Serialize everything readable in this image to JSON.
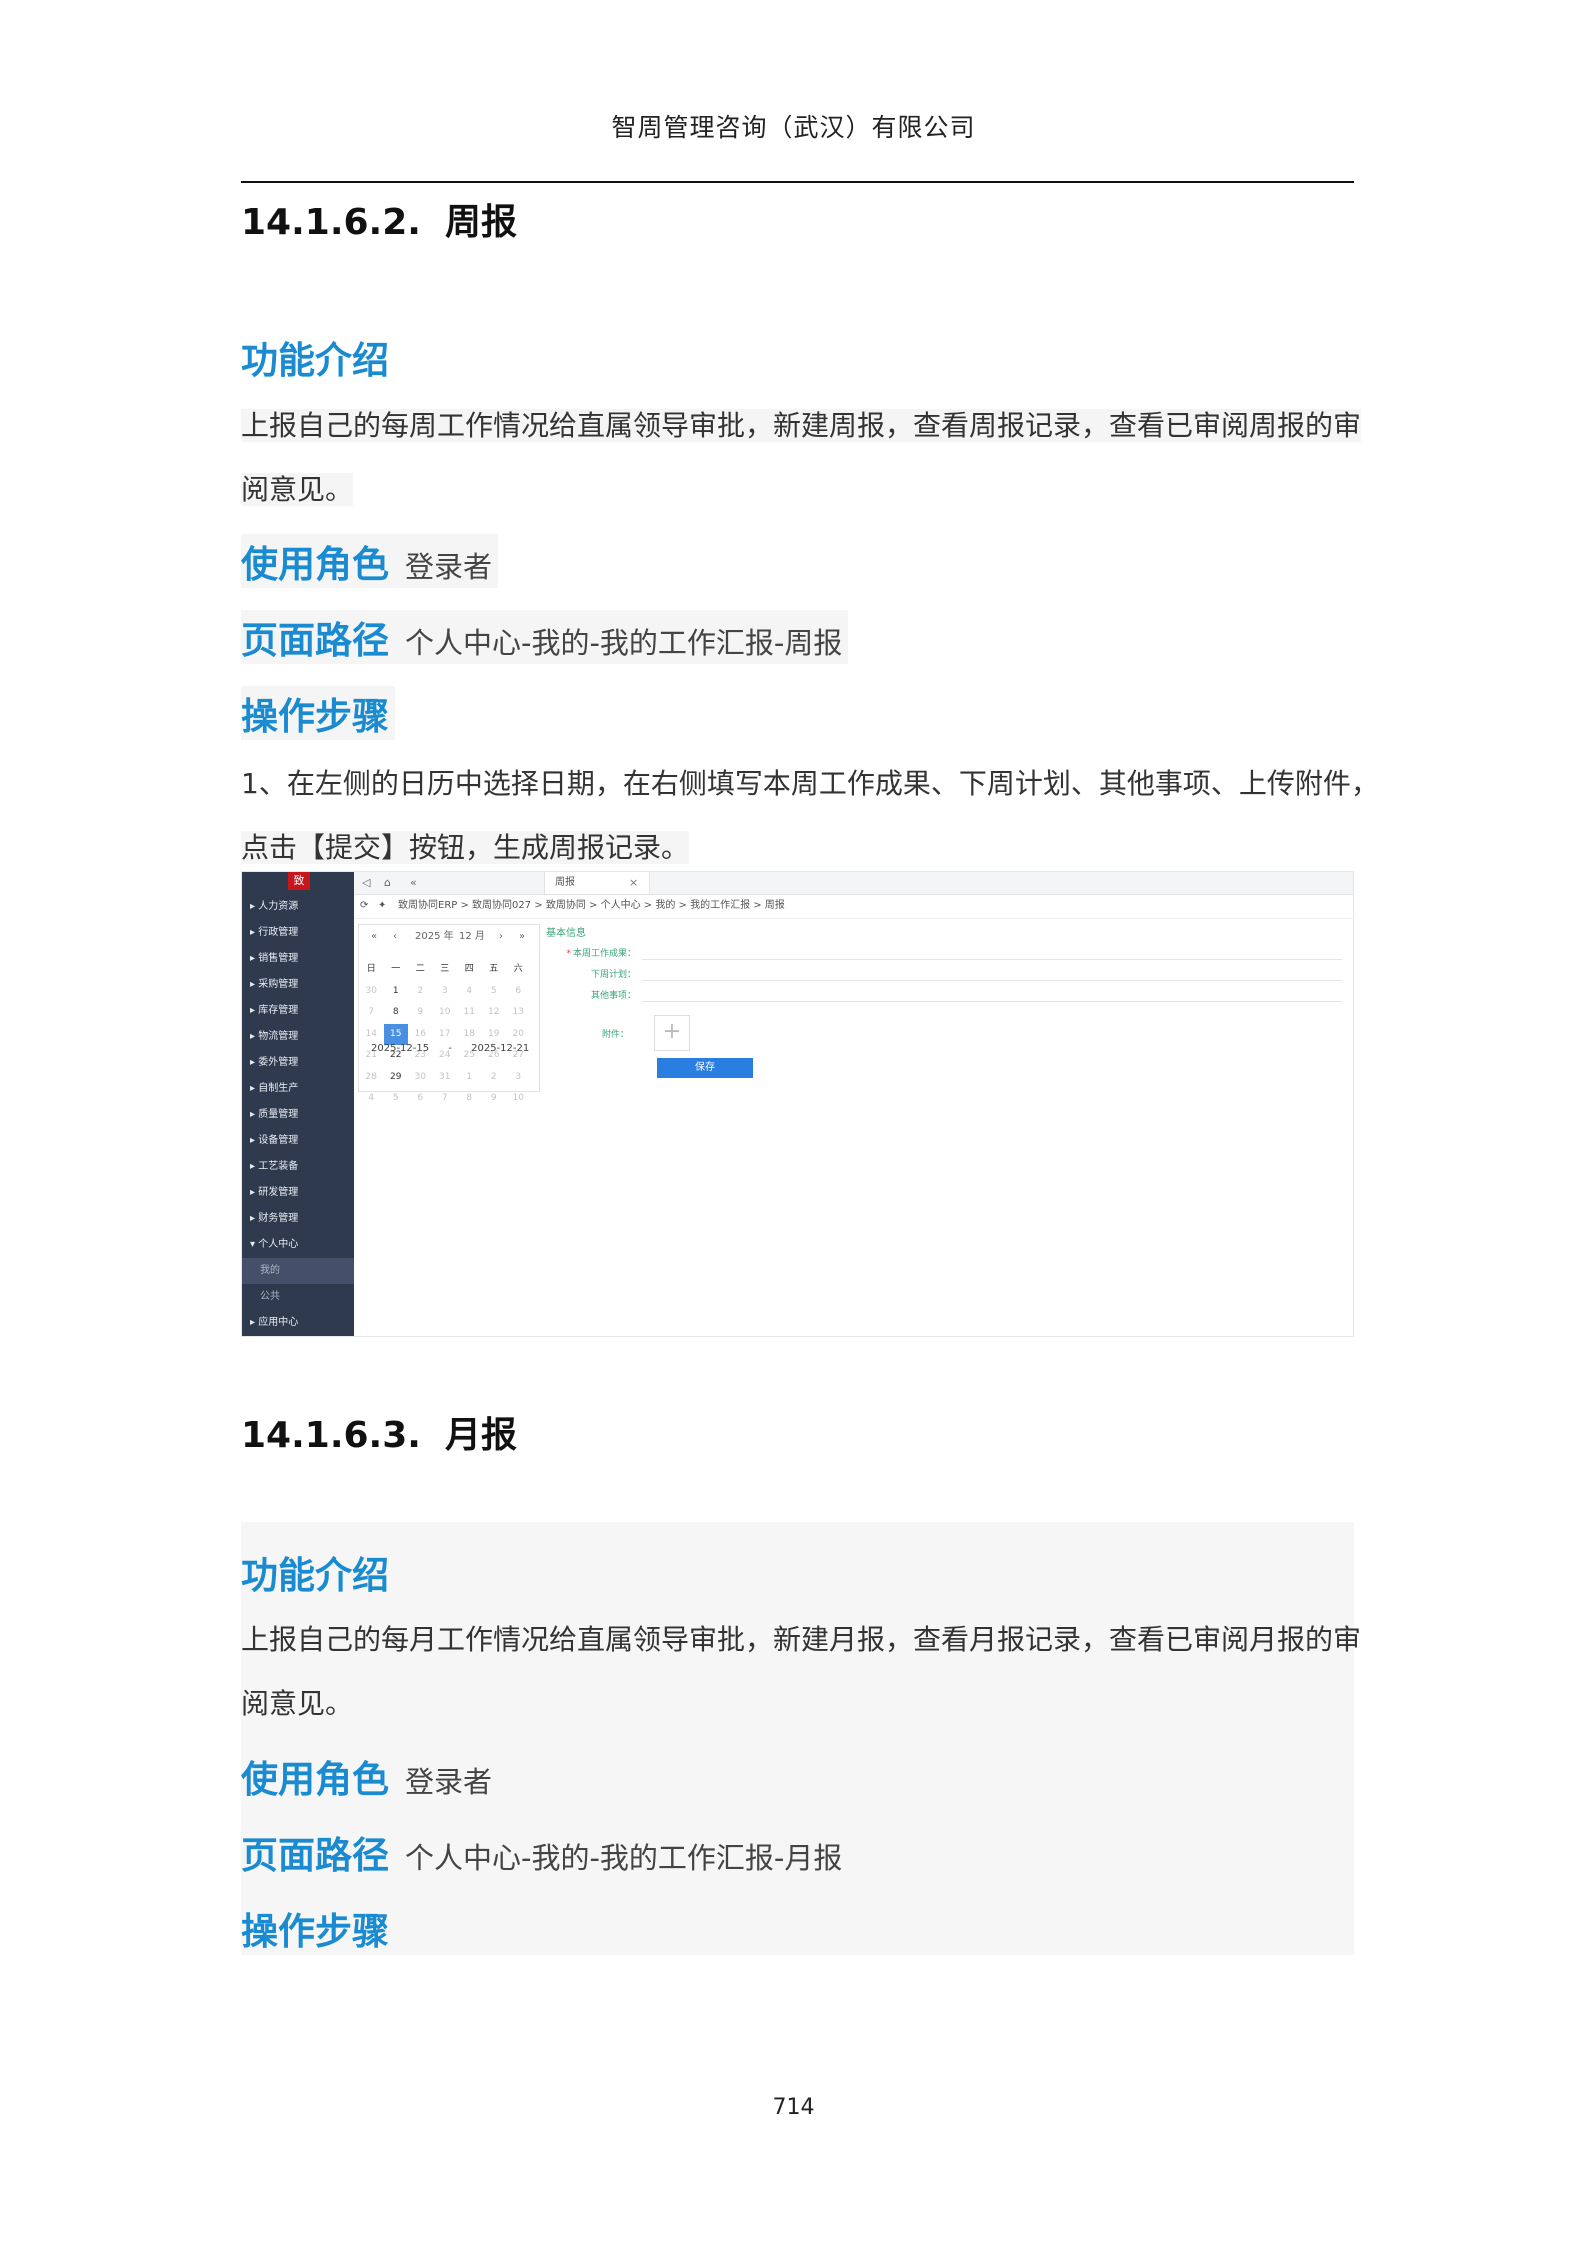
{
  "header": {
    "company": "智周管理咨询（武汉）有限公司"
  },
  "section_weekly": {
    "number": "14.1.6.2.",
    "title": "周报",
    "intro_label": "功能介绍",
    "intro_line1": "上报自己的每周工作情况给直属领导审批，新建周报，查看周报记录，查看已审阅周报的审",
    "intro_line2": "阅意见。",
    "role_label": "使用角色",
    "role_value": "登录者",
    "path_label": "页面路径",
    "path_value": "个人中心-我的-我的工作汇报-周报",
    "steps_label": "操作步骤",
    "step_line1": "1、在左侧的日历中选择日期，在右侧填写本周工作成果、下周计划、其他事项、上传附件，",
    "step_line2": "点击【提交】按钮，生成周报记录。"
  },
  "screenshot": {
    "logo": "致",
    "sidebar_items": [
      "人力资源",
      "行政管理",
      "销售管理",
      "采购管理",
      "库存管理",
      "物流管理",
      "委外管理",
      "自制生产",
      "质量管理",
      "设备管理",
      "工艺装备",
      "研发管理",
      "财务管理",
      "个人中心"
    ],
    "sidebar_sub": [
      "我的",
      "公共"
    ],
    "sidebar_last": "应用中心",
    "tab_label": "周报",
    "tab_close": "×",
    "breadcrumb": "致周协同ERP > 致周协同027 > 致周协同 > 个人中心 > 我的 > 我的工作汇报 > 周报",
    "calendar": {
      "year": "2025 年",
      "month": "12 月",
      "weekdays": [
        "日",
        "一",
        "二",
        "三",
        "四",
        "五",
        "六"
      ],
      "weeks": [
        [
          "30",
          "1",
          "2",
          "3",
          "4",
          "5",
          "6"
        ],
        [
          "7",
          "8",
          "9",
          "10",
          "11",
          "12",
          "13"
        ],
        [
          "14",
          "15",
          "16",
          "17",
          "18",
          "19",
          "20"
        ],
        [
          "21",
          "22",
          "23",
          "24",
          "25",
          "26",
          "27"
        ],
        [
          "28",
          "29",
          "30",
          "31",
          "1",
          "2",
          "3"
        ],
        [
          "4",
          "5",
          "6",
          "7",
          "8",
          "9",
          "10"
        ]
      ],
      "selected": "15",
      "range_start": "2025-12-15",
      "range_sep": "-",
      "range_end": "2025-12-21"
    },
    "form": {
      "title": "基本信息",
      "field1": "本周工作成果：",
      "field2": "下周计划：",
      "field3": "其他事项：",
      "attach": "附件：",
      "upload_plus": "+",
      "save": "保存"
    }
  },
  "section_monthly": {
    "number": "14.1.6.3.",
    "title": "月报",
    "intro_label": "功能介绍",
    "intro_line1": "上报自己的每月工作情况给直属领导审批，新建月报，查看月报记录，查看已审阅月报的审",
    "intro_line2": "阅意见。",
    "role_label": "使用角色",
    "role_value": "登录者",
    "path_label": "页面路径",
    "path_value": "个人中心-我的-我的工作汇报-月报",
    "steps_label": "操作步骤"
  },
  "footer": {
    "page_number": "714"
  }
}
